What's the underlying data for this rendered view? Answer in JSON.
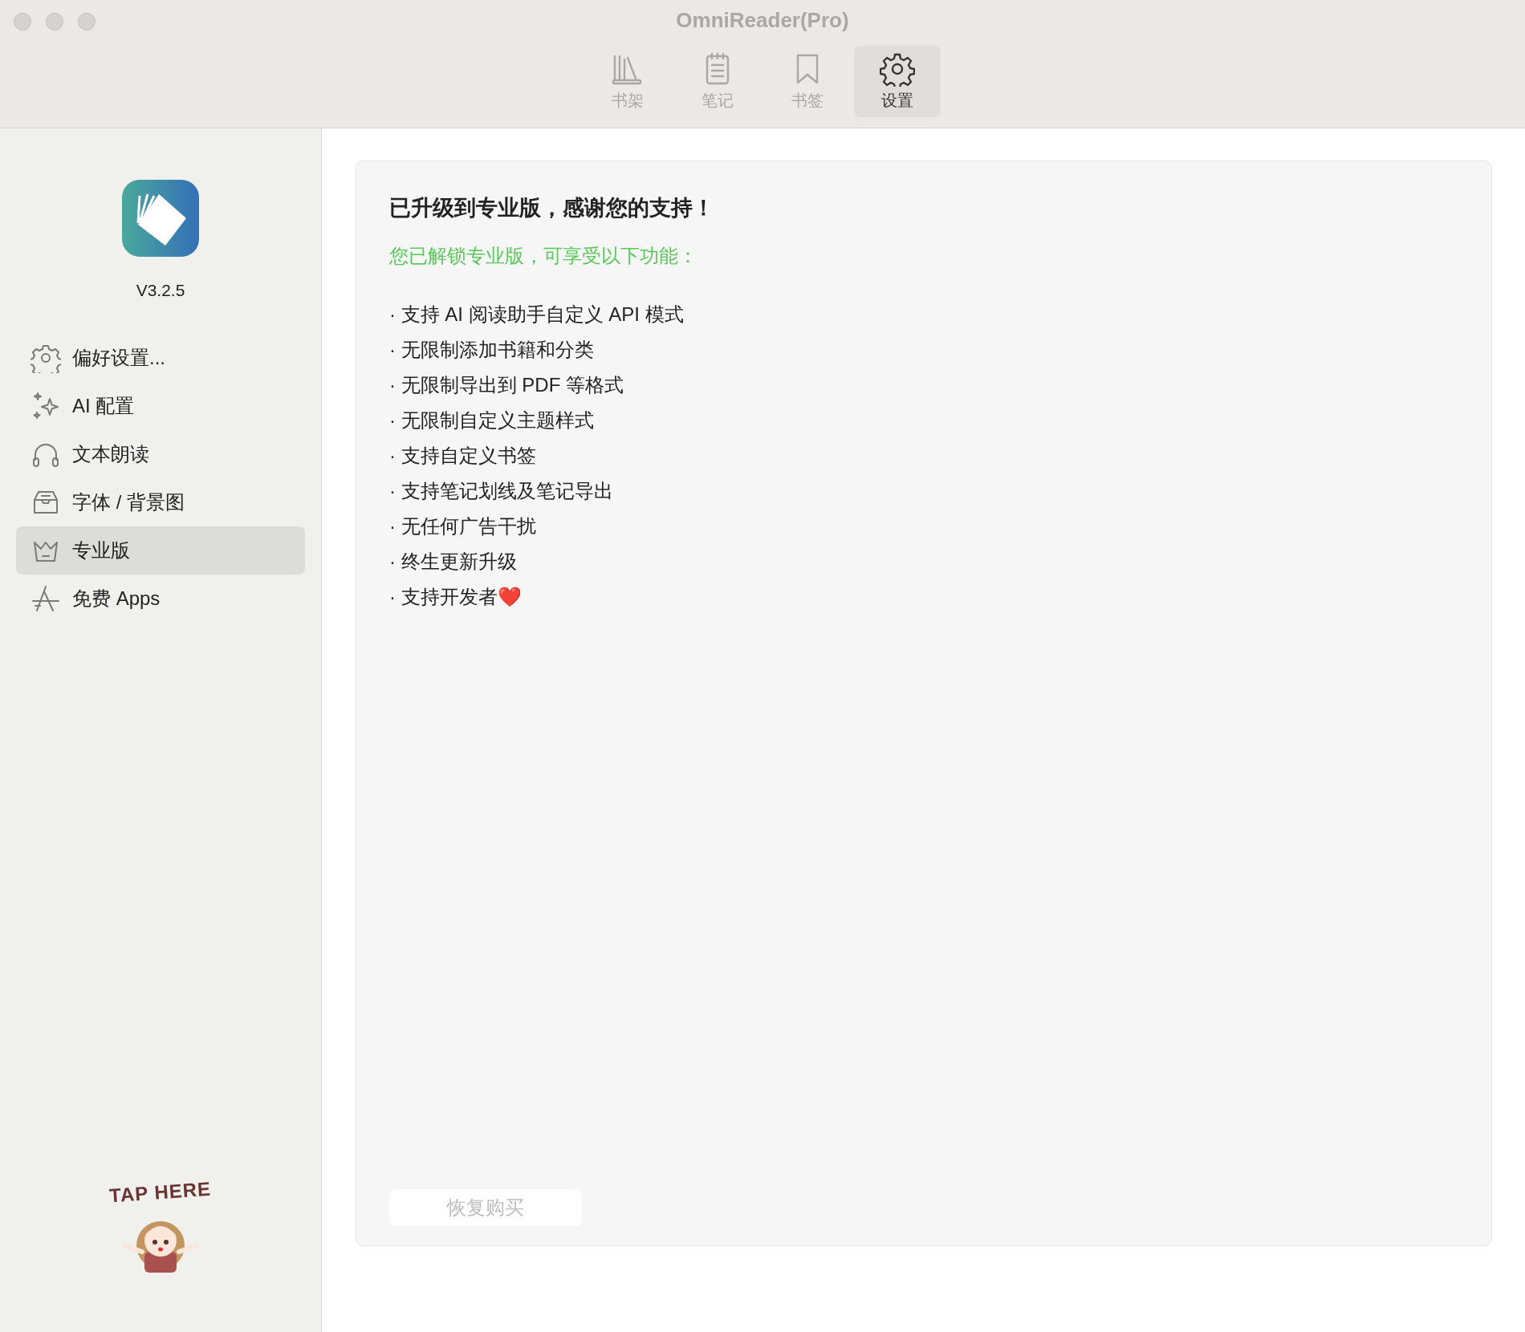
{
  "window": {
    "title": "OmniReader(Pro)"
  },
  "toolbar_tabs": [
    {
      "label": "书架",
      "selected": false
    },
    {
      "label": "笔记",
      "selected": false
    },
    {
      "label": "书签",
      "selected": false
    },
    {
      "label": "设置",
      "selected": true
    }
  ],
  "sidebar": {
    "version": "V3.2.5",
    "items": [
      {
        "label": "偏好设置...",
        "selected": false
      },
      {
        "label": "AI 配置",
        "selected": false
      },
      {
        "label": "文本朗读",
        "selected": false
      },
      {
        "label": "字体 / 背景图",
        "selected": false
      },
      {
        "label": "专业版",
        "selected": true
      },
      {
        "label": "免费 Apps",
        "selected": false
      }
    ],
    "sticker": {
      "text": "TAP HERE"
    }
  },
  "content": {
    "title": "已升级到专业版，感谢您的支持！",
    "subtitle": "您已解锁专业版，可享受以下功能：",
    "features": [
      "· 支持 AI 阅读助手自定义 API 模式",
      "· 无限制添加书籍和分类",
      "· 无限制导出到 PDF 等格式",
      "· 无限制自定义主题样式",
      "· 支持自定义书签",
      "· 支持笔记划线及笔记导出",
      "· 无任何广告干扰",
      "· 终生更新升级",
      "· 支持开发者❤️"
    ],
    "restore_button": "恢复购买"
  }
}
